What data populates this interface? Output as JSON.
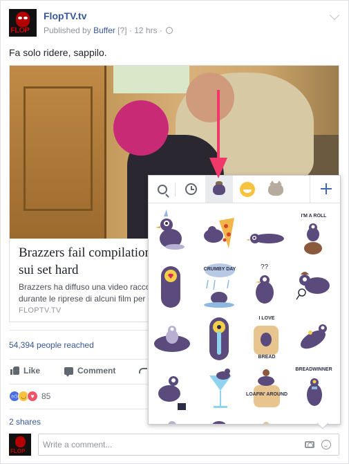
{
  "post": {
    "page_name": "FlopTV.tv",
    "published_by_prefix": "Published by",
    "published_by": "Buffer",
    "info_marker": "[?]",
    "time": "· 12 hrs ·",
    "text": "Fa solo ridere, sappilo.",
    "avatar_logo_text": "FLOP"
  },
  "link_preview": {
    "title_line1": "Brazzers fail compilation",
    "title_line2": "sui set hard",
    "description_line1": "Brazzers ha diffuso una video racco",
    "description_line2": "durante le riprese di alcuni film per a",
    "domain": "FLOPTV.TV"
  },
  "reach": "54,394 people reached",
  "actions": {
    "like": "Like",
    "comment": "Comment"
  },
  "reactions": {
    "count": "85",
    "types": [
      "like",
      "haha",
      "love"
    ]
  },
  "shares": "2 shares",
  "comment_box": {
    "placeholder": "Write a comment..."
  },
  "sticker_picker": {
    "tabs": [
      "search-icon",
      "recent-clock-icon",
      "pigeon-pack-icon",
      "emoji-grin-icon",
      "cat-pack-icon",
      "add-plus-icon"
    ],
    "active_tab": "pigeon-pack-icon",
    "sticker_texts": {
      "im_a_roll": "I'M A ROLL",
      "crumby_day": "CRUMBY DAY",
      "i_love": "I LOVE",
      "bread": "BREAD",
      "loafin_around": "LOAFIN' AROUND",
      "breadwinner": "BREADWINNER"
    }
  },
  "colors": {
    "link_blue": "#365899",
    "annotation_pink": "#f0386b",
    "pigeon_purple": "#5b4a7c"
  }
}
